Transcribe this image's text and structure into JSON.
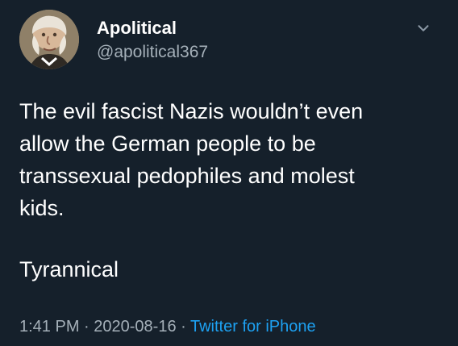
{
  "user": {
    "display_name": "Apolitical",
    "handle": "@apolitical367",
    "avatar_icon": "portrait-avatar-icon"
  },
  "tweet": {
    "lines": [
      "The evil fascist Nazis wouldn’t even",
      "allow the German people to be",
      "transsexual pedophiles and molest",
      "kids."
    ],
    "second_paragraph": "Tyrannical"
  },
  "meta": {
    "time": "1:41 PM",
    "separator_1": " · ",
    "date": "2020-08-16",
    "separator_2": " · ",
    "source": "Twitter for iPhone"
  },
  "colors": {
    "background": "#15202b",
    "text": "#ffffff",
    "muted": "#a5b0b9",
    "link": "#1da1f2"
  },
  "icons": {
    "caret": "chevron-down-icon"
  }
}
